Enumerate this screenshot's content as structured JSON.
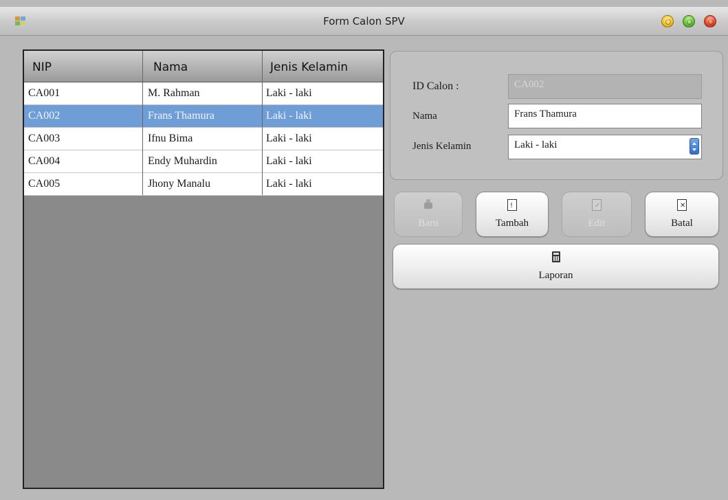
{
  "window": {
    "title": "Form Calon SPV"
  },
  "grid": {
    "columns": [
      "NIP",
      "Nama",
      "Jenis Kelamin"
    ],
    "rows": [
      {
        "nip": "CA001",
        "nama": "M. Rahman",
        "jk": "Laki - laki"
      },
      {
        "nip": "CA002",
        "nama": "Frans Thamura",
        "jk": "Laki - laki"
      },
      {
        "nip": "CA003",
        "nama": "Ifnu Bima",
        "jk": "Laki - laki"
      },
      {
        "nip": "CA004",
        "nama": "Endy Muhardin",
        "jk": "Laki - laki"
      },
      {
        "nip": "CA005",
        "nama": "Jhony Manalu",
        "jk": "Laki - laki"
      }
    ],
    "selected_index": 1
  },
  "form": {
    "id_label": "ID Calon :",
    "id_value": "CA002",
    "nama_label": "Nama",
    "nama_value": "Frans Thamura",
    "jk_label": "Jenis Kelamin",
    "jk_value": "Laki - laki"
  },
  "buttons": {
    "baru": "Baru",
    "tambah": "Tambah",
    "edit": "Edit",
    "batal": "Batal",
    "laporan": "Laporan"
  }
}
